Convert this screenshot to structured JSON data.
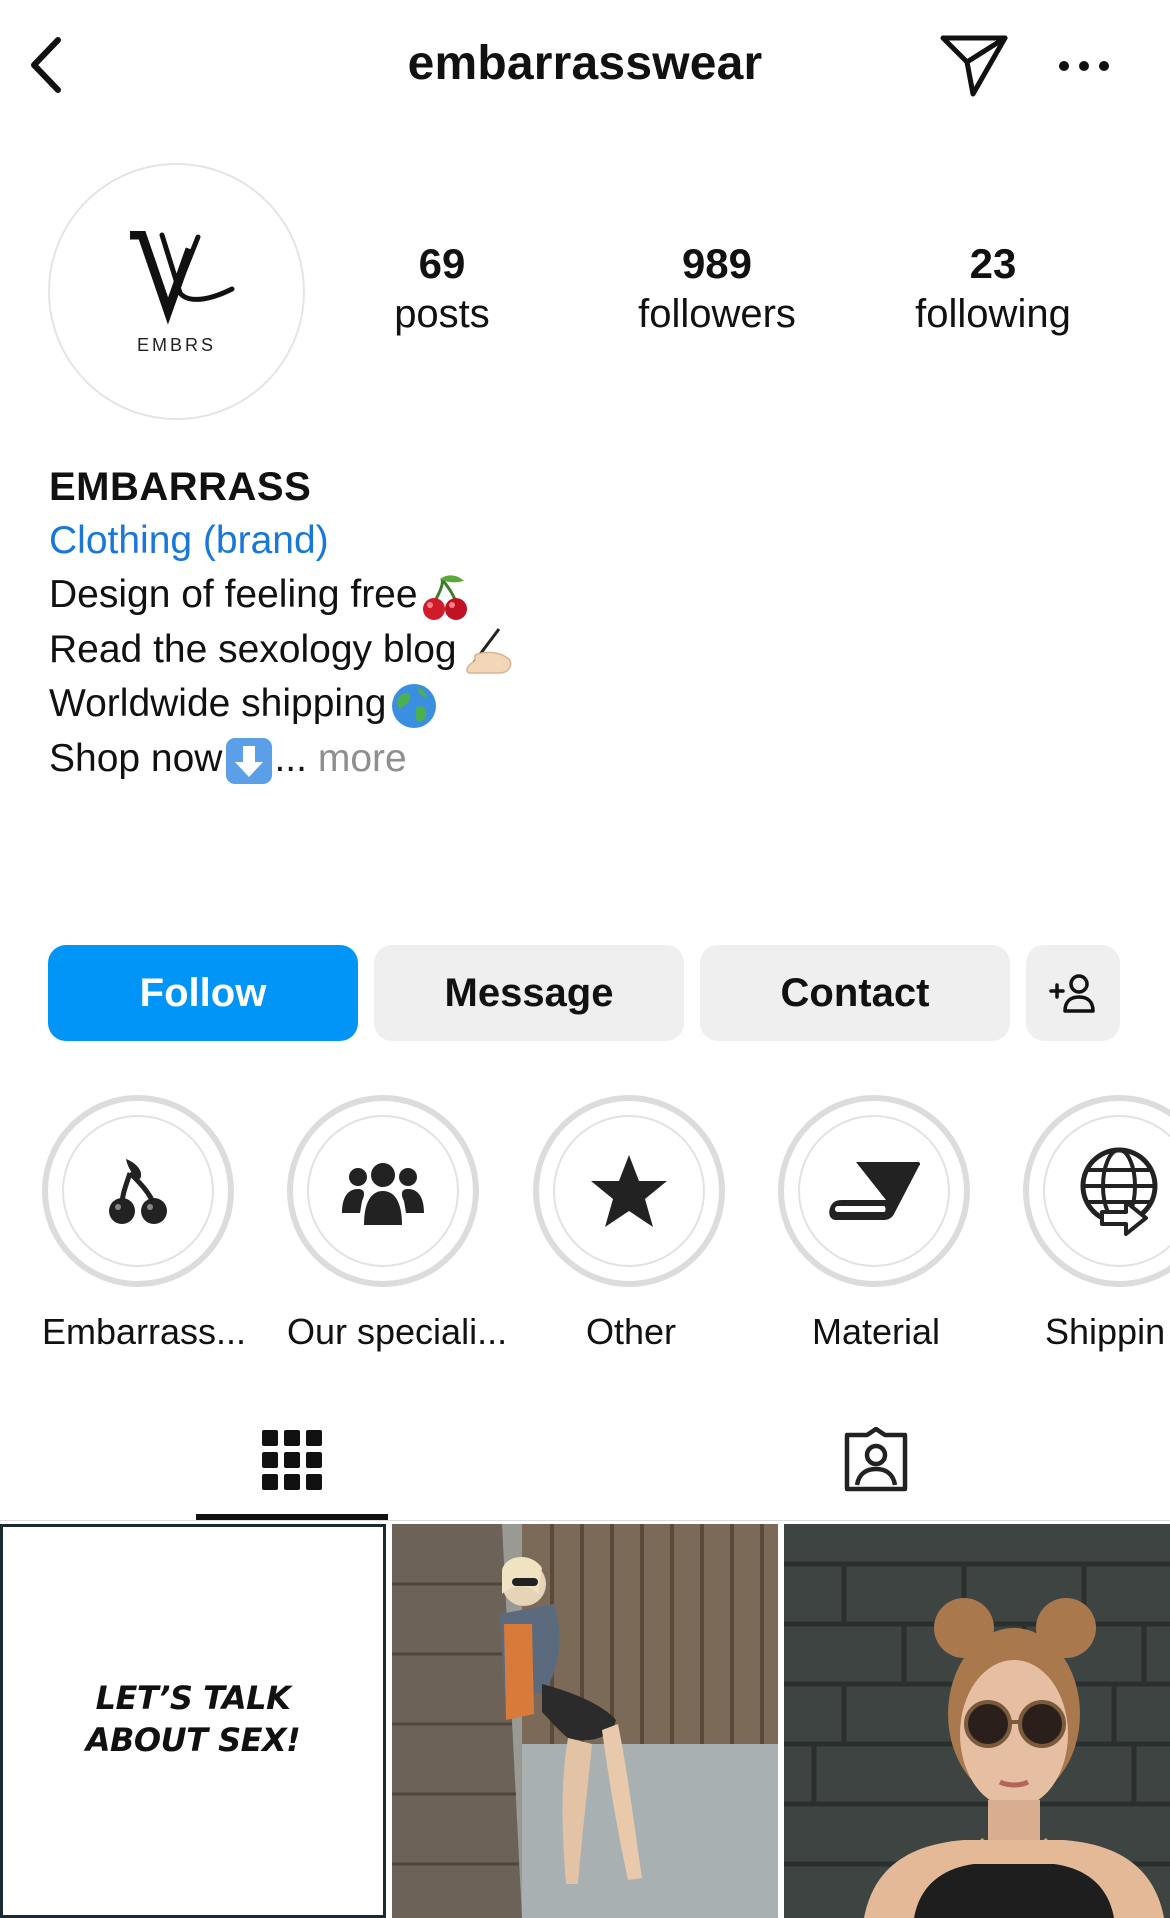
{
  "header": {
    "username": "embarrasswear",
    "back_icon": "chevron-left-icon",
    "send_icon": "paper-plane-icon",
    "more_icon": "ellipsis-icon"
  },
  "profile": {
    "avatar_text": "EMBRS",
    "stats": [
      {
        "value": "69",
        "label": "posts"
      },
      {
        "value": "989",
        "label": "followers"
      },
      {
        "value": "23",
        "label": "following"
      }
    ],
    "name": "EMBARRASS",
    "category": "Clothing (brand)",
    "bio_lines": [
      "Design of feeling free",
      "Read the sexology blog",
      "Worldwide shipping",
      "Shop now"
    ],
    "bio_ellipsis": "...",
    "more_label": "more"
  },
  "actions": {
    "follow": "Follow",
    "message": "Message",
    "contact": "Contact",
    "add_user_icon": "add-person-icon"
  },
  "highlights": [
    {
      "label": "Embarrass...",
      "icon": "cherry-icon"
    },
    {
      "label": "Our speciali...",
      "icon": "group-icon"
    },
    {
      "label": "Other",
      "icon": "star-icon"
    },
    {
      "label": "Material",
      "icon": "book-icon"
    },
    {
      "label": "Shippin",
      "icon": "globe-arrow-icon"
    }
  ],
  "tabs": [
    {
      "name": "grid",
      "icon": "grid-icon",
      "active": true
    },
    {
      "name": "tagged",
      "icon": "tagged-person-icon",
      "active": false
    }
  ],
  "posts": [
    {
      "text_line1": "LET’S TALK",
      "text_line2": "ABOUT SEX!"
    },
    {
      "kind": "photo"
    },
    {
      "kind": "photo"
    }
  ],
  "colors": {
    "follow_button": "#0095f6",
    "category_link": "#1877d8",
    "secondary_button": "#efefef",
    "muted_text": "#8e8e8e"
  }
}
